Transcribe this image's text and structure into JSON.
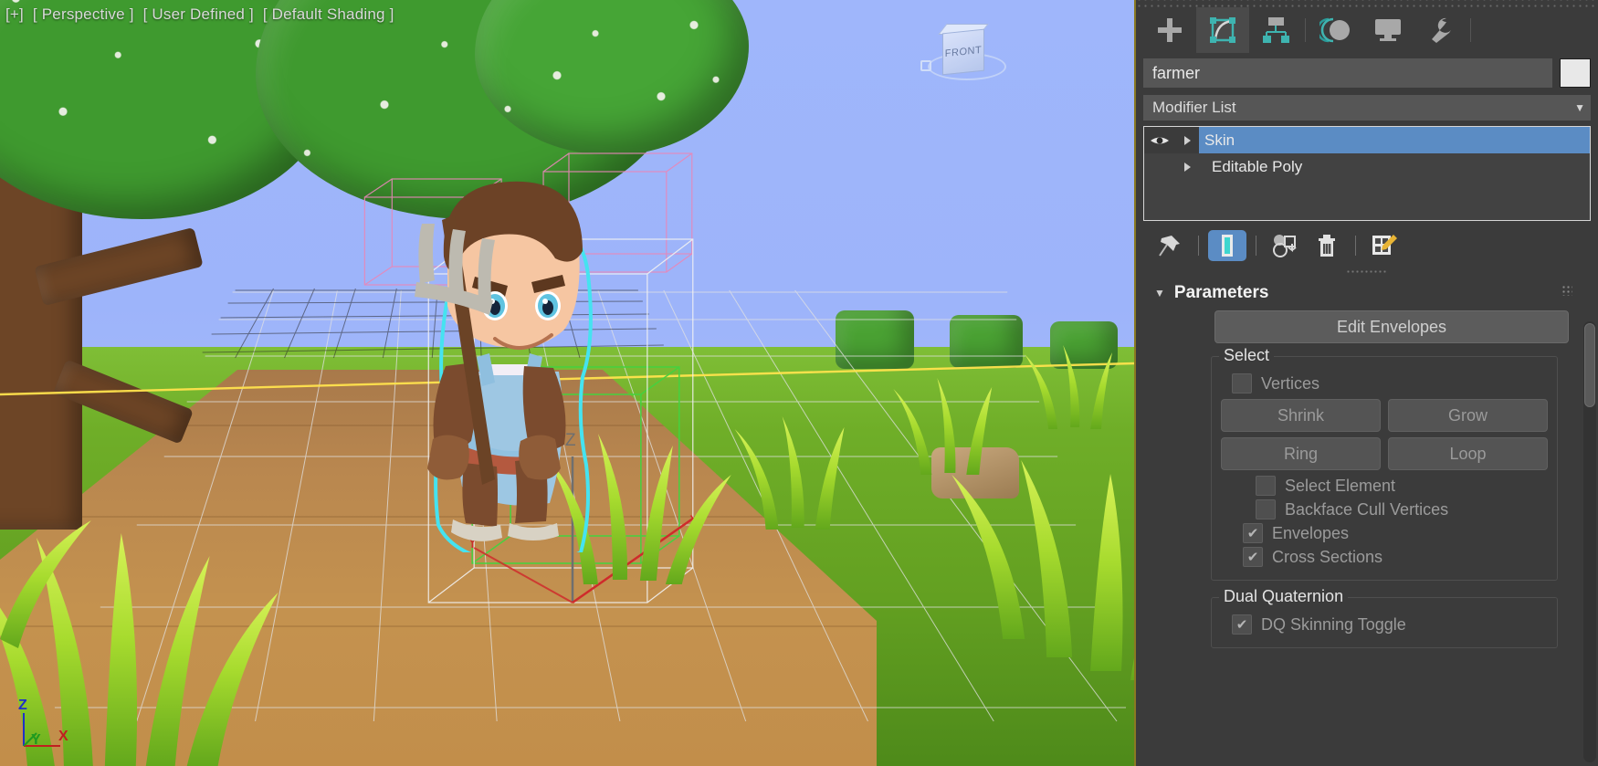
{
  "viewport": {
    "label_parts": [
      "[+]",
      "[ Perspective ]",
      "[ User Defined ]",
      "[ Default Shading ]"
    ],
    "viewcube_face": "FRONT",
    "axis": {
      "x": "X",
      "y": "Y",
      "z": "Z"
    },
    "gizmo_axis_labels": {
      "z": "Z",
      "y": "Y",
      "x": "X"
    }
  },
  "panel": {
    "tabs": [
      {
        "name": "create",
        "icon": "plus-icon",
        "active": false
      },
      {
        "name": "modify",
        "icon": "modify-icon",
        "active": true
      },
      {
        "name": "hierarchy",
        "icon": "hierarchy-icon",
        "active": false
      },
      {
        "name": "motion",
        "icon": "motion-icon",
        "active": false
      },
      {
        "name": "display",
        "icon": "display-icon",
        "active": false
      },
      {
        "name": "utilities",
        "icon": "wrench-icon",
        "active": false
      }
    ],
    "object_name": "farmer",
    "object_color": "#e8e8e8",
    "modifier_list_label": "Modifier List",
    "stack": [
      {
        "label": "Skin",
        "selected": true,
        "has_eye": true
      },
      {
        "label": "Editable Poly",
        "selected": false,
        "has_eye": false
      }
    ],
    "stack_tools": [
      {
        "name": "pin-stack-icon",
        "active": false
      },
      {
        "name": "show-end-result-icon",
        "active": true
      },
      {
        "name": "make-unique-icon",
        "active": false
      },
      {
        "name": "remove-modifier-icon",
        "active": false
      },
      {
        "name": "configure-modifier-sets-icon",
        "active": false
      }
    ],
    "rollout": {
      "title": "Parameters",
      "collapsed": false,
      "edit_envelopes_label": "Edit Envelopes",
      "select_group": {
        "legend": "Select",
        "vertices": {
          "label": "Vertices",
          "checked": false
        },
        "shrink": "Shrink",
        "grow": "Grow",
        "ring": "Ring",
        "loop": "Loop",
        "select_element": {
          "label": "Select Element",
          "checked": false
        },
        "backface_cull": {
          "label": "Backface Cull Vertices",
          "checked": false
        },
        "envelopes": {
          "label": "Envelopes",
          "checked": true
        },
        "cross_sections": {
          "label": "Cross Sections",
          "checked": true
        }
      },
      "dual_quaternion_group": {
        "legend": "Dual Quaternion",
        "dq_toggle": {
          "label": "DQ Skinning Toggle",
          "checked": true
        }
      }
    }
  },
  "colors": {
    "panel_bg": "#3b3b3b",
    "selection_blue": "#5b8cc4",
    "accent_teal": "#3eb4b0",
    "divider_gold": "#8a7a22",
    "selected_mesh_outline": "#45e3f0"
  }
}
